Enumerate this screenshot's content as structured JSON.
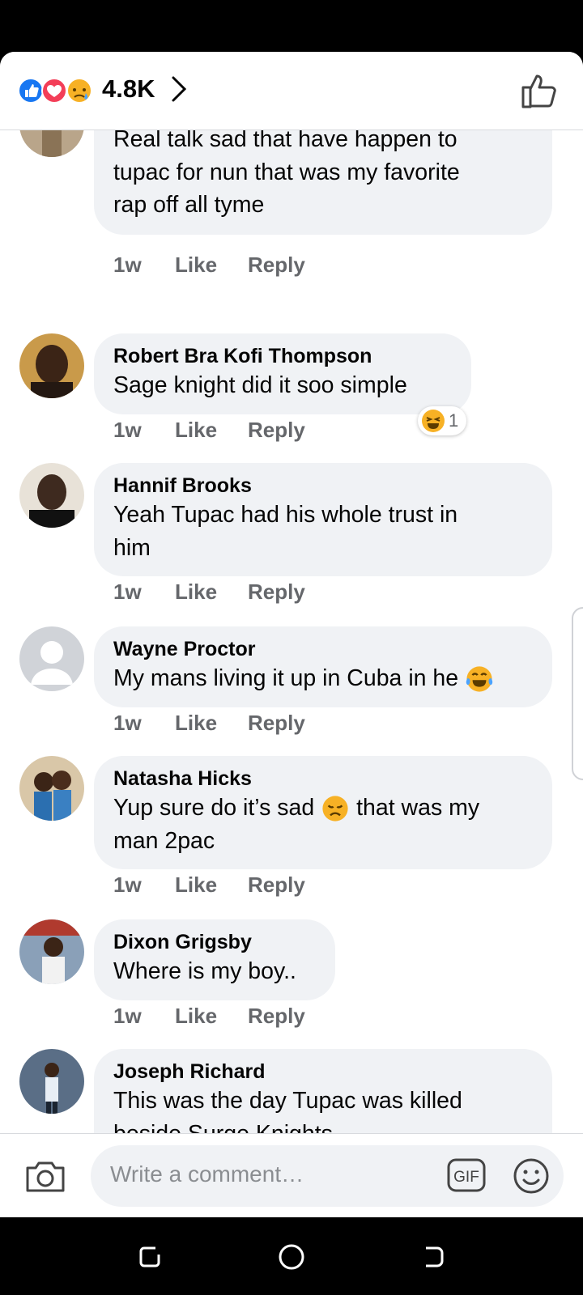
{
  "reactions": {
    "count": "4.8K",
    "icons": [
      "like-reaction-icon",
      "love-reaction-icon",
      "sad-reaction-icon"
    ]
  },
  "comments": [
    {
      "author": "",
      "text_lines": [
        "Real talk sad that have happen to",
        "tupac for nun that was my favorite",
        "rap off all tyme"
      ],
      "time": "1w",
      "like": "Like",
      "reply": "Reply"
    },
    {
      "author": "Robert Bra Kofi Thompson",
      "text_lines": [
        "Sage knight did it soo simple"
      ],
      "time": "1w",
      "like": "Like",
      "reply": "Reply",
      "reaction": {
        "icon": "laughing-emoji-icon",
        "count": "1"
      }
    },
    {
      "author": "Hannif Brooks",
      "text_lines": [
        "Yeah Tupac had his whole trust in",
        "him"
      ],
      "time": "1w",
      "like": "Like",
      "reply": "Reply"
    },
    {
      "author": "Wayne Proctor",
      "text_lines": [
        "My mans living it up in Cuba in he"
      ],
      "time": "1w",
      "like": "Like",
      "reply": "Reply"
    },
    {
      "author": "Natasha Hicks",
      "text_lines": [
        "Yup sure do it’s sad",
        "man 2pac"
      ],
      "text_line1_after_emoji": "that was my",
      "time": "1w",
      "like": "Like",
      "reply": "Reply"
    },
    {
      "author": "Dixon Grigsby",
      "text_lines": [
        "Where is my boy.."
      ],
      "time": "1w",
      "like": "Like",
      "reply": "Reply"
    },
    {
      "author": "Joseph Richard",
      "text_lines": [
        "This was the day Tupac was killed",
        "beside Surge Knights"
      ]
    }
  ],
  "composer": {
    "placeholder": "Write a comment…",
    "gif_label": "GIF"
  },
  "colors": {
    "bubble": "#f0f2f5",
    "meta": "#65676b",
    "like_blue": "#1877f2",
    "love_red": "#f33e58"
  }
}
